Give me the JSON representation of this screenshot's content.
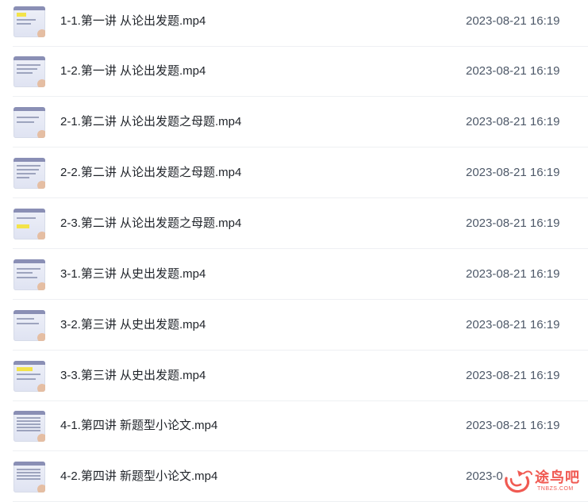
{
  "files": [
    {
      "name": "1-1.第一讲 从论出发题.mp4",
      "modified": "2023-08-21 16:19",
      "thumbnail": "video-thumbnail"
    },
    {
      "name": "1-2.第一讲 从论出发题.mp4",
      "modified": "2023-08-21 16:19",
      "thumbnail": "video-thumbnail"
    },
    {
      "name": "2-1.第二讲 从论出发题之母题.mp4",
      "modified": "2023-08-21 16:19",
      "thumbnail": "video-thumbnail"
    },
    {
      "name": "2-2.第二讲 从论出发题之母题.mp4",
      "modified": "2023-08-21 16:19",
      "thumbnail": "video-thumbnail"
    },
    {
      "name": "2-3.第二讲 从论出发题之母题.mp4",
      "modified": "2023-08-21 16:19",
      "thumbnail": "video-thumbnail"
    },
    {
      "name": "3-1.第三讲 从史出发题.mp4",
      "modified": "2023-08-21 16:19",
      "thumbnail": "video-thumbnail"
    },
    {
      "name": "3-2.第三讲 从史出发题.mp4",
      "modified": "2023-08-21 16:19",
      "thumbnail": "video-thumbnail"
    },
    {
      "name": "3-3.第三讲 从史出发题.mp4",
      "modified": "2023-08-21 16:19",
      "thumbnail": "video-thumbnail"
    },
    {
      "name": "4-1.第四讲 新题型小论文.mp4",
      "modified": "2023-08-21 16:19",
      "thumbnail": "video-thumbnail"
    },
    {
      "name": "4-2.第四讲 新题型小论文.mp4",
      "modified": "2023-0",
      "thumbnail": "video-thumbnail"
    }
  ],
  "watermark": {
    "title": "途鸟吧",
    "subtitle": "TNBZS.COM",
    "logo": "tnbzs-logo-icon"
  },
  "colors": {
    "text": "#1f2329",
    "time": "#4e5969",
    "divider": "#eef0f3",
    "watermark": "#f05a52"
  }
}
